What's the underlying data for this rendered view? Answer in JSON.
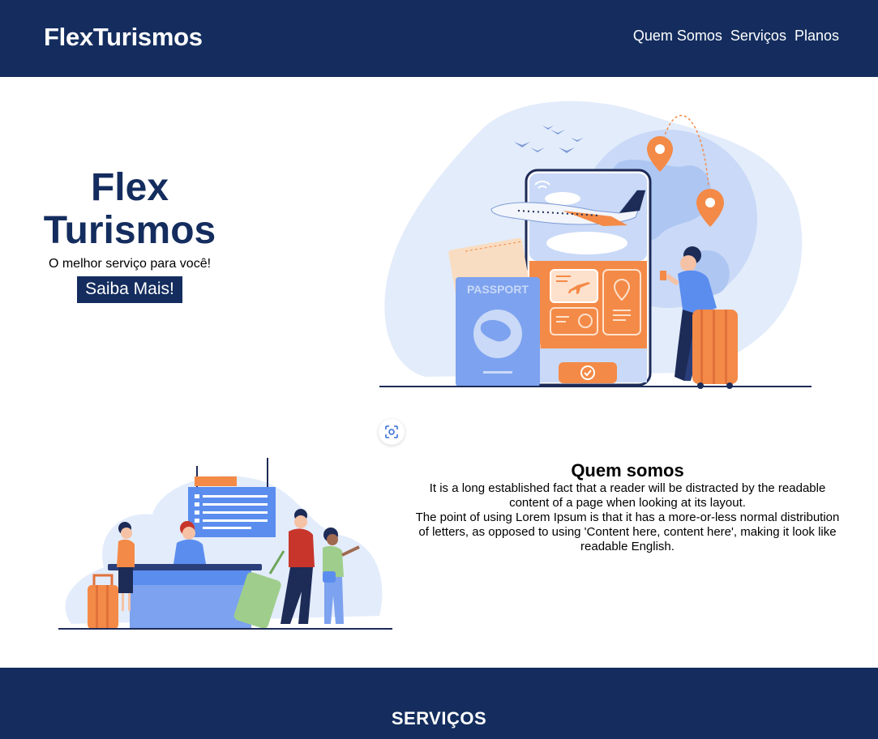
{
  "header": {
    "logo": "FlexTurismos",
    "nav": [
      "Quem Somos",
      "Serviços",
      "Planos"
    ]
  },
  "hero": {
    "title_line1": "Flex",
    "title_line2": "Turismos",
    "subtitle": "O melhor serviço para você!",
    "cta_label": "Saiba Mais!",
    "illustration": {
      "passport_label": "PASSPORT",
      "icon_names": [
        "airplane-icon",
        "location-pin-icon",
        "wifi-icon",
        "checkmark-icon",
        "clock-icon"
      ]
    }
  },
  "about": {
    "title": "Quem somos",
    "paragraph1": "It is a long established fact that a reader will be distracted by the readable content of a page when looking at its layout.",
    "paragraph2": "The point of using Lorem Ipsum is that it has a more-or-less normal distribution of letters, as opposed to using 'Content here, content here', making it look like readable English."
  },
  "services": {
    "title": "SERVIÇOS"
  },
  "colors": {
    "primary": "#142d5e",
    "accent_orange": "#f48a47",
    "accent_blue": "#5b8def",
    "light_blue": "#dfe9fb"
  }
}
